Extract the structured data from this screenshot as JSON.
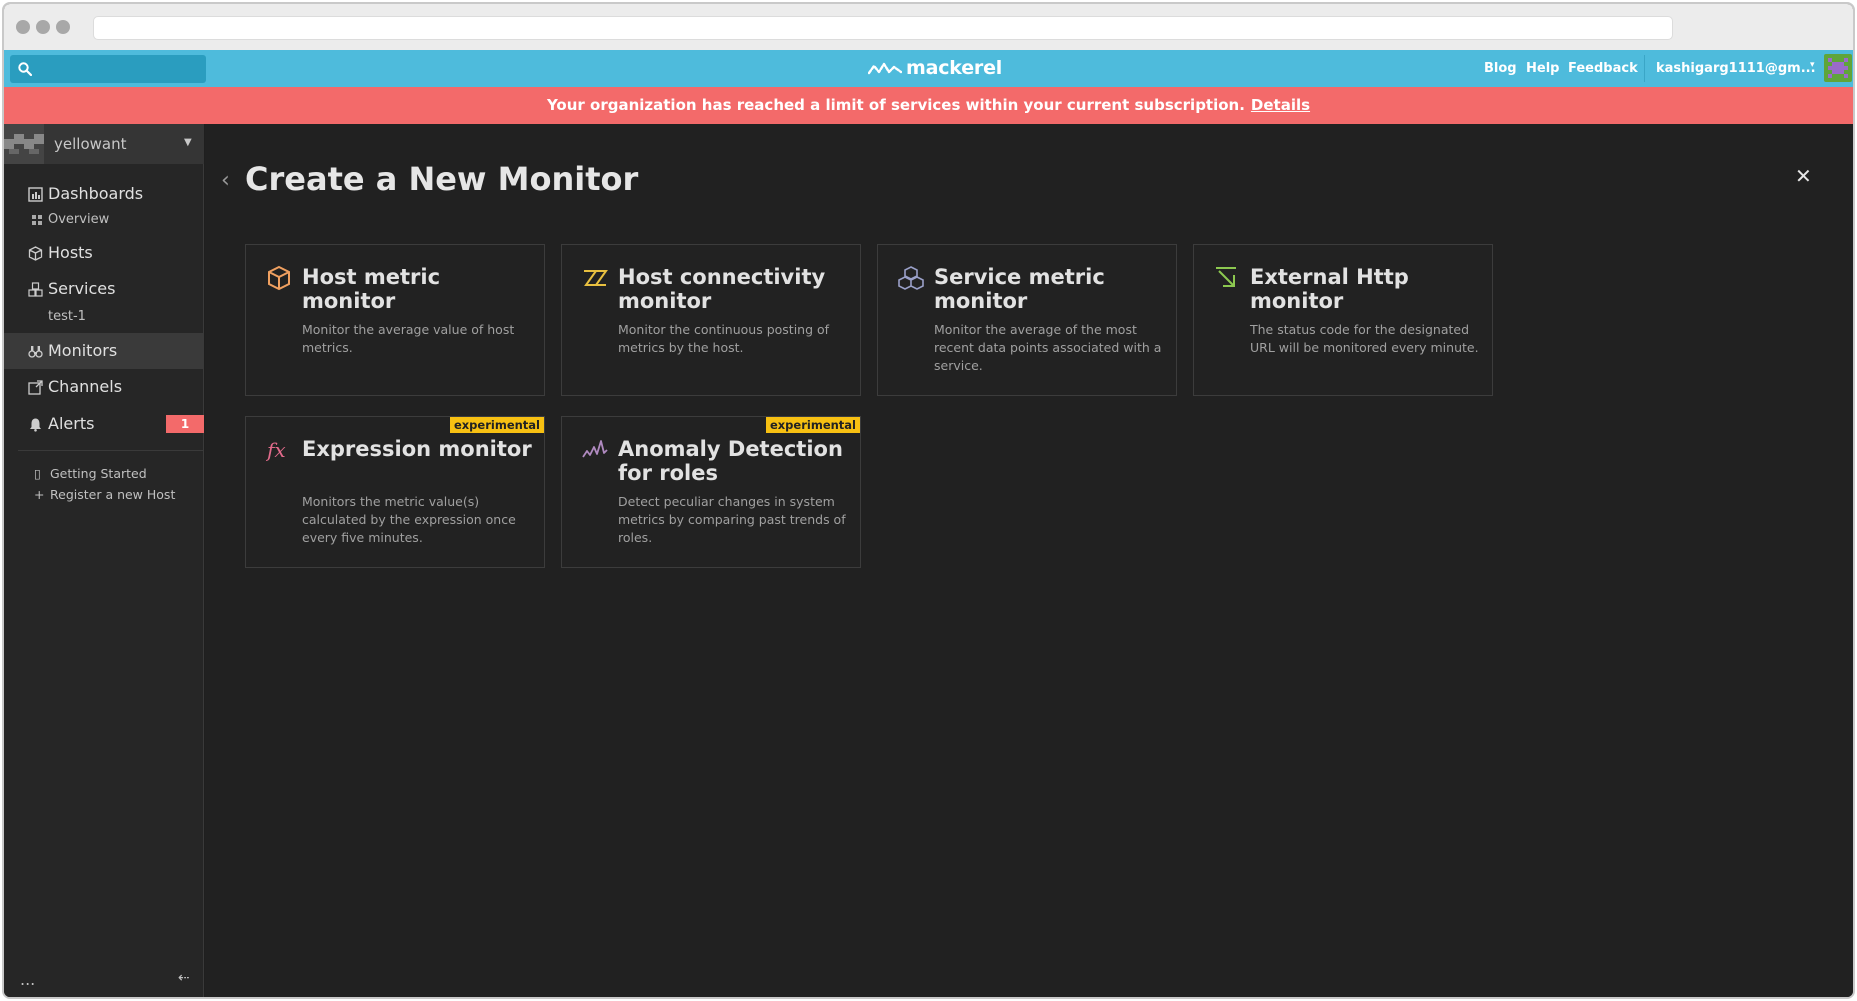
{
  "browser": {
    "address": ""
  },
  "topbar": {
    "search_placeholder": "",
    "logo_text": "mackerel",
    "links": [
      "Blog",
      "Help",
      "Feedback"
    ],
    "user_email": "kashigarg1111@gm...",
    "caret": "▾"
  },
  "banner": {
    "message": "Your organization has reached a limit of services within your current subscription.",
    "link": "Details"
  },
  "sidebar": {
    "org_name": "yellowant",
    "org_caret": "▼",
    "items": [
      {
        "label": "Dashboards",
        "icon": "dashboard-icon"
      },
      {
        "label": "Hosts",
        "icon": "cube-icon"
      },
      {
        "label": "Services",
        "icon": "services-icon"
      },
      {
        "label": "Monitors",
        "icon": "binoculars-icon"
      },
      {
        "label": "Channels",
        "icon": "channel-icon"
      },
      {
        "label": "Alerts",
        "icon": "bell-icon"
      }
    ],
    "sub_dashboards": "Overview",
    "sub_services": "test-1",
    "alerts_count": "1",
    "footer_links": [
      {
        "label": "Getting Started",
        "icon": "document-icon",
        "glyph": "▯"
      },
      {
        "label": "Register a new Host",
        "icon": "plus-icon",
        "glyph": "+"
      }
    ],
    "more": "...",
    "collapse": "⇠"
  },
  "main": {
    "back": "‹",
    "title": "Create a New Monitor",
    "close": "✕",
    "cards": [
      {
        "title": "Host metric monitor",
        "desc": "Monitor the average value of host metrics.",
        "icon": "host-metric-icon",
        "badge": ""
      },
      {
        "title": "Host connectivity monitor",
        "desc": "Monitor the continuous posting of metrics by the host.",
        "icon": "connectivity-icon",
        "badge": ""
      },
      {
        "title": "Service metric monitor",
        "desc": "Monitor the average of the most recent data points associated with a service.",
        "icon": "service-metric-icon",
        "badge": ""
      },
      {
        "title": "External Http monitor",
        "desc": "The status code for the designated URL will be monitored every minute.",
        "icon": "external-http-icon",
        "badge": ""
      },
      {
        "title": "Expression monitor",
        "desc": "Monitors the metric value(s) calculated by the expression once every five minutes.",
        "icon": "expression-icon",
        "badge": "experimental"
      },
      {
        "title": "Anomaly Detection for roles",
        "desc": "Detect peculiar changes in system metrics by comparing past trends of roles.",
        "icon": "anomaly-icon",
        "badge": "experimental"
      }
    ]
  },
  "colors": {
    "topbar": "#4ebbdc",
    "banner": "#f36a6a",
    "badge": "#f7c012",
    "background": "#212121"
  }
}
